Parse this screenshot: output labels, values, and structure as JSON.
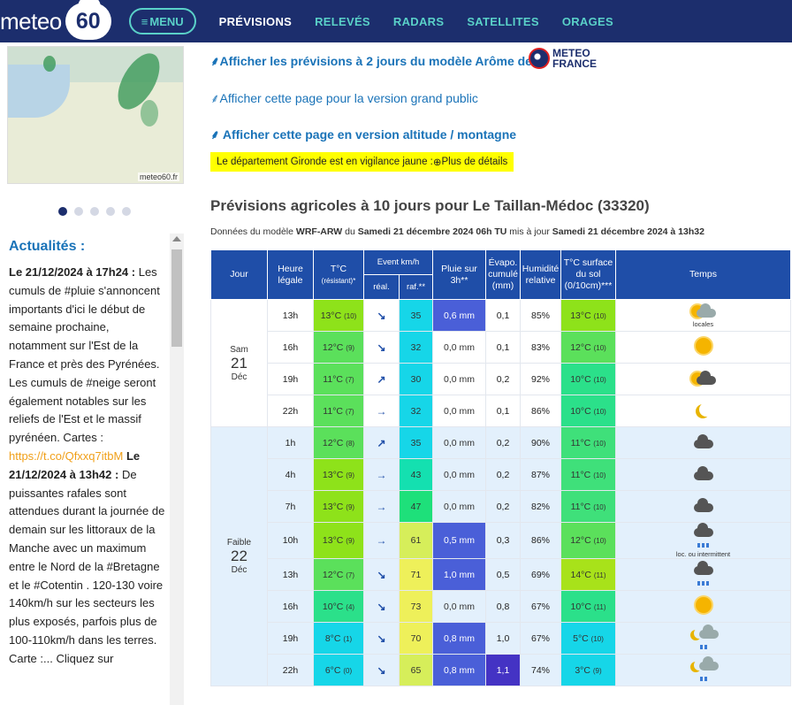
{
  "header": {
    "logo_text": "meteo",
    "logo_number": "60",
    "menu_label": "MENU",
    "nav": [
      "PRÉVISIONS",
      "RELEVÉS",
      "RADARS",
      "SATELLITES",
      "ORAGES"
    ]
  },
  "sidebar": {
    "map_credit": "meteo60.fr",
    "news_title": "Actualités :",
    "news": {
      "d1": "Le 21/12/2024 à 17h24 :",
      "t1": " Les cumuls de #pluie s'annoncent importants d'ici le début de semaine prochaine, notamment sur l'Est de la France et près des Pyrénées. Les cumuls de #neige seront également notables sur les reliefs de l'Est et le massif pyrénéen. Cartes : ",
      "link": "https://t.co/Qfxxq7itbM",
      "d2": " Le 21/12/2024 à 13h42 :",
      "t2": " De puissantes rafales sont attendues durant la journée de demain sur les littoraux de la Manche avec un maximum entre le Nord de la #Bretagne et le #Cotentin . 120-130 voire 140km/h sur les secteurs les plus exposés, parfois plus de 100-110km/h dans les terres. Carte :... Cliquez sur"
    }
  },
  "main": {
    "link_arome": "Afficher les prévisions à 2 jours du modèle Arôme de",
    "mf_logo": [
      "METEO",
      "FRANCE"
    ],
    "link_public": "Afficher cette page pour la version grand public",
    "link_altitude": "Afficher cette page en version altitude / montagne",
    "vigilance_text": "Le département Gironde est en vigilance jaune :",
    "vigilance_more": "Plus de détails",
    "title": "Prévisions agricoles à 10 jours pour Le Taillan-Médoc (33320)",
    "model_info": {
      "p1": "Données du modèle ",
      "model": "WRF-ARW",
      "p2": " du ",
      "run": "Samedi 21 décembre 2024 06h TU",
      "p3": " mis à jour ",
      "updated": "Samedi 21 décembre 2024 à 13h32"
    }
  },
  "table": {
    "headers": {
      "jour": "Jour",
      "heure": "Heure légale",
      "temp": "T°C",
      "temp_sub": "(résistant)*",
      "event": "Event km/h",
      "event_real": "réal.",
      "event_raf": "raf.**",
      "pluie": "Pluie sur 3h**",
      "evapo": "Évapo. cumulé (mm)",
      "humid": "Humidité relative",
      "tsol": "T°C surface du sol (0/10cm)***",
      "temps": "Temps"
    },
    "days": [
      {
        "label": "Sam",
        "num": "21",
        "month": "Déc",
        "risk": "",
        "rows": [
          {
            "h": "13h",
            "t": "13°C",
            "tr": "(10)",
            "tcolor": "#8ee21a",
            "dir": "↘",
            "raf": "35",
            "rcolor": "#16d6e8",
            "pluie": "0,6 mm",
            "pcolor": "#4a5fd8",
            "ptext": "#fff",
            "evapo": "0,1",
            "ecolor": "",
            "hum": "85%",
            "ts": "13°C",
            "tsr": "(10)",
            "tscolor": "#8ee21a",
            "wx": "sun-cloud",
            "note": "locales"
          },
          {
            "h": "16h",
            "t": "12°C",
            "tr": "(9)",
            "tcolor": "#5be05b",
            "dir": "↘",
            "raf": "32",
            "rcolor": "#16d6e8",
            "pluie": "0,0 mm",
            "pcolor": "",
            "ptext": "",
            "evapo": "0,1",
            "ecolor": "",
            "hum": "83%",
            "ts": "12°C",
            "tsr": "(10)",
            "tscolor": "#5be05b",
            "wx": "sun",
            "note": ""
          },
          {
            "h": "19h",
            "t": "11°C",
            "tr": "(7)",
            "tcolor": "#5be05b",
            "dir": "↗",
            "raf": "30",
            "rcolor": "#16d6e8",
            "pluie": "0,0 mm",
            "pcolor": "",
            "ptext": "",
            "evapo": "0,2",
            "ecolor": "",
            "hum": "92%",
            "ts": "10°C",
            "tsr": "(10)",
            "tscolor": "#2be08a",
            "wx": "sun-cloud-dark",
            "note": ""
          },
          {
            "h": "22h",
            "t": "11°C",
            "tr": "(7)",
            "tcolor": "#5be05b",
            "dir": "→",
            "raf": "32",
            "rcolor": "#16d6e8",
            "pluie": "0,0 mm",
            "pcolor": "",
            "ptext": "",
            "evapo": "0,1",
            "ecolor": "",
            "hum": "86%",
            "ts": "10°C",
            "tsr": "(10)",
            "tscolor": "#2be08a",
            "wx": "moon",
            "note": ""
          }
        ]
      },
      {
        "label": "",
        "num": "22",
        "month": "Déc",
        "risk": "Faible",
        "rows": [
          {
            "h": "1h",
            "t": "12°C",
            "tr": "(8)",
            "tcolor": "#5be05b",
            "dir": "↗",
            "raf": "35",
            "rcolor": "#16d6e8",
            "pluie": "0,0 mm",
            "pcolor": "",
            "ptext": "",
            "evapo": "0,2",
            "ecolor": "",
            "hum": "90%",
            "ts": "11°C",
            "tsr": "(10)",
            "tscolor": "#3fe07a",
            "wx": "cloud",
            "note": ""
          },
          {
            "h": "4h",
            "t": "13°C",
            "tr": "(9)",
            "tcolor": "#8ee21a",
            "dir": "→",
            "raf": "43",
            "rcolor": "#14e0b0",
            "pluie": "0,0 mm",
            "pcolor": "",
            "ptext": "",
            "evapo": "0,2",
            "ecolor": "",
            "hum": "87%",
            "ts": "11°C",
            "tsr": "(10)",
            "tscolor": "#3fe07a",
            "wx": "cloud",
            "note": ""
          },
          {
            "h": "7h",
            "t": "13°C",
            "tr": "(9)",
            "tcolor": "#8ee21a",
            "dir": "→",
            "raf": "47",
            "rcolor": "#1ee07a",
            "pluie": "0,0 mm",
            "pcolor": "",
            "ptext": "",
            "evapo": "0,2",
            "ecolor": "",
            "hum": "82%",
            "ts": "11°C",
            "tsr": "(10)",
            "tscolor": "#3fe07a",
            "wx": "cloud",
            "note": ""
          },
          {
            "h": "10h",
            "t": "13°C",
            "tr": "(9)",
            "tcolor": "#8ee21a",
            "dir": "→",
            "raf": "61",
            "rcolor": "#d6ee5a",
            "pluie": "0,5 mm",
            "pcolor": "#4a5fd8",
            "ptext": "#fff",
            "evapo": "0,3",
            "ecolor": "",
            "hum": "86%",
            "ts": "12°C",
            "tsr": "(10)",
            "tscolor": "#5be05b",
            "wx": "rain",
            "note": "loc. ou intermittent"
          },
          {
            "h": "13h",
            "t": "12°C",
            "tr": "(7)",
            "tcolor": "#5be05b",
            "dir": "↘",
            "raf": "71",
            "rcolor": "#eef05a",
            "pluie": "1,0 mm",
            "pcolor": "#4a5fd8",
            "ptext": "#fff",
            "evapo": "0,5",
            "ecolor": "",
            "hum": "69%",
            "ts": "14°C",
            "tsr": "(11)",
            "tscolor": "#a8e21a",
            "wx": "rain",
            "note": ""
          },
          {
            "h": "16h",
            "t": "10°C",
            "tr": "(4)",
            "tcolor": "#2be08a",
            "dir": "↘",
            "raf": "73",
            "rcolor": "#eef05a",
            "pluie": "0,0 mm",
            "pcolor": "",
            "ptext": "",
            "evapo": "0,8",
            "ecolor": "",
            "hum": "67%",
            "ts": "10°C",
            "tsr": "(11)",
            "tscolor": "#2be08a",
            "wx": "sun",
            "note": ""
          },
          {
            "h": "19h",
            "t": "8°C",
            "tr": "(1)",
            "tcolor": "#16d6e8",
            "dir": "↘",
            "raf": "70",
            "rcolor": "#eef05a",
            "pluie": "0,8 mm",
            "pcolor": "#4a5fd8",
            "ptext": "#fff",
            "evapo": "1,0",
            "ecolor": "",
            "hum": "67%",
            "ts": "5°C",
            "tsr": "(10)",
            "tscolor": "#16d6e8",
            "wx": "moon-rain",
            "note": ""
          },
          {
            "h": "22h",
            "t": "6°C",
            "tr": "(0)",
            "tcolor": "#16d6e8",
            "dir": "↘",
            "raf": "65",
            "rcolor": "#d6ee5a",
            "pluie": "0,8 mm",
            "pcolor": "#4a5fd8",
            "ptext": "#fff",
            "evapo": "1,1",
            "ecolor": "#4433c4",
            "hum": "74%",
            "ts": "3°C",
            "tsr": "(9)",
            "tscolor": "#16d6e8",
            "wx": "moon-rain",
            "note": ""
          }
        ]
      }
    ]
  }
}
